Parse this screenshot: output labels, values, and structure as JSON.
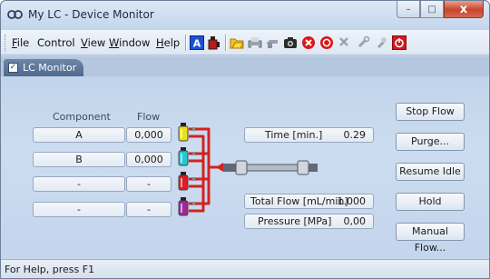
{
  "window": {
    "title": "My LC - Device Monitor",
    "controls": {
      "minimize": "–",
      "maximize": "□",
      "close": "x"
    }
  },
  "menu": [
    {
      "accel": "F",
      "rest": "ile"
    },
    {
      "accel": "",
      "rest": "Control"
    },
    {
      "accel": "V",
      "rest": "iew"
    },
    {
      "accel": "W",
      "rest": "indow"
    },
    {
      "accel": "H",
      "rest": "elp"
    }
  ],
  "toolbar": {
    "icons": [
      "about-icon",
      "bottle-icon",
      "method-icon",
      "print-icon",
      "snapshot-icon",
      "camera-icon",
      "stop-icon",
      "record-icon",
      "tools-icon",
      "tools2-icon",
      "wrench-icon",
      "power-icon"
    ]
  },
  "tabs": [
    {
      "label": "LC Monitor",
      "checked": true
    }
  ],
  "monitor": {
    "headers": {
      "component": "Component",
      "flow": "Flow"
    },
    "rows": [
      {
        "component": "A",
        "flow": "0,000",
        "bottle_color": "#e8e01a"
      },
      {
        "component": "B",
        "flow": "0,000",
        "bottle_color": "#22c9cf"
      },
      {
        "component": "-",
        "flow": "-",
        "bottle_color": "#e01c24"
      },
      {
        "component": "-",
        "flow": "-",
        "bottle_color": "#9a2a9a"
      }
    ],
    "time": {
      "label": "Time [min.]",
      "value": "0.29"
    },
    "total_flow": {
      "label": "Total Flow [mL/min]",
      "value": "1.000"
    },
    "pressure": {
      "label": "Pressure [MPa]",
      "value": "0,00"
    },
    "buttons": {
      "stop_flow": "Stop Flow",
      "purge": "Purge...",
      "resume_idle": "Resume Idle",
      "hold": "Hold",
      "manual_flow": "Manual Flow..."
    },
    "pipe_color": "#d2231f"
  },
  "status": {
    "text": "For Help, press F1"
  }
}
